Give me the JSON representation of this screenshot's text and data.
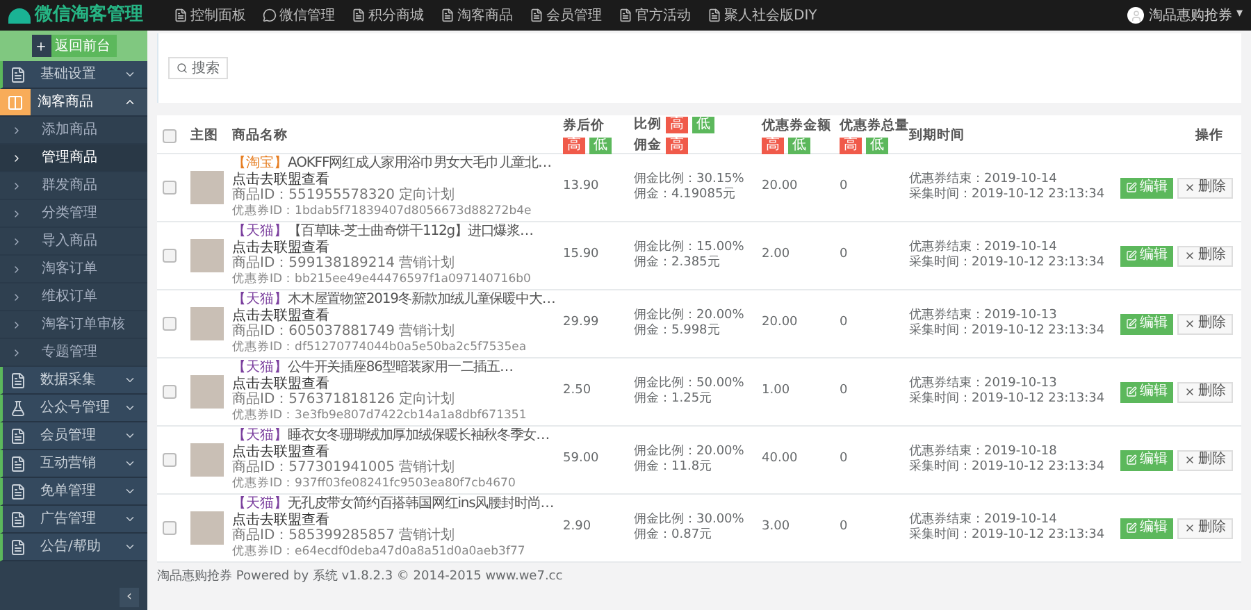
{
  "header": {
    "logo": "微信淘客管理",
    "nav": [
      {
        "label": "控制面板"
      },
      {
        "label": "微信管理"
      },
      {
        "label": "积分商城"
      },
      {
        "label": "淘客商品"
      },
      {
        "label": "会员管理"
      },
      {
        "label": "官方活动"
      },
      {
        "label": "聚人社会版DIY"
      }
    ],
    "user": "淘品惠购抢券",
    "user_caret": "▾"
  },
  "sidebar": {
    "home_button": "返回前台",
    "menu": [
      {
        "label": "基础设置",
        "selected": false,
        "expanded": false
      },
      {
        "label": "淘客商品",
        "selected": true,
        "expanded": true,
        "children": [
          {
            "label": "添加商品",
            "selected": false
          },
          {
            "label": "管理商品",
            "selected": true
          },
          {
            "label": "群发商品",
            "selected": false
          },
          {
            "label": "分类管理",
            "selected": false
          },
          {
            "label": "导入商品",
            "selected": false
          },
          {
            "label": "淘客订单",
            "selected": false
          },
          {
            "label": "维权订单",
            "selected": false
          },
          {
            "label": "淘客订单审核",
            "selected": false
          },
          {
            "label": "专题管理",
            "selected": false
          }
        ]
      },
      {
        "label": "数据采集",
        "selected": false,
        "expanded": false
      },
      {
        "label": "公众号管理",
        "selected": false,
        "expanded": false
      },
      {
        "label": "会员管理",
        "selected": false,
        "expanded": false
      },
      {
        "label": "互动营销",
        "selected": false,
        "expanded": false
      },
      {
        "label": "免单管理",
        "selected": false,
        "expanded": false
      },
      {
        "label": "广告管理",
        "selected": false,
        "expanded": false
      },
      {
        "label": "公告/帮助",
        "selected": false,
        "expanded": false
      }
    ],
    "collapse_button": "‹"
  },
  "search_button": "搜索",
  "table": {
    "select_all_checked": false,
    "columns": [
      {
        "label": "主图"
      },
      {
        "label": "商品名称"
      },
      {
        "label": "券后价",
        "badges": [
          {
            "label": "高",
            "color": "#f05a4a"
          },
          {
            "label": "低",
            "color": "#5cb85c"
          }
        ]
      },
      {
        "label": "比例",
        "badges": [
          {
            "label": "高",
            "color": "#f05a4a"
          },
          {
            "label": "低",
            "color": "#5cb85c"
          }
        ],
        "second_label": "佣金",
        "second_badges": [
          {
            "label": "高",
            "color": "#f05a4a"
          }
        ]
      },
      {
        "label": "优惠券金额",
        "badges": [
          {
            "label": "高",
            "color": "#f05a4a"
          },
          {
            "label": "低",
            "color": "#5cb85c"
          }
        ]
      },
      {
        "label": "优惠券总量",
        "badges": [
          {
            "label": "高",
            "color": "#f05a4a"
          },
          {
            "label": "低",
            "color": "#5cb85c"
          }
        ]
      },
      {
        "label": "到期时间"
      },
      {
        "label": "操作"
      }
    ],
    "rows": [
      {
        "checked": false,
        "platform": {
          "label": "【淘宝】",
          "color": "#e67e22"
        },
        "title": "AOKFF网红成人家用浴巾男女大毛巾儿童北…",
        "link": "点击去联盟查看",
        "item_id": "商品ID：551955578320 定向计划",
        "coupon_id": "优惠券ID：1bdab5f71839407d8056673d88272b4e",
        "price": "13.90",
        "ratio": "佣金比例：30.15%",
        "commission": "佣金：4.19085元",
        "coupon_amount": "20.00",
        "coupon_total": "0",
        "coupon_end": "优惠券结束：2019-10-14",
        "collected": "采集时间：2019-10-12 23:13:34",
        "edit": "编辑",
        "delete": "删除"
      },
      {
        "checked": false,
        "platform": {
          "label": "【天猫】",
          "color": "#7b3f9e"
        },
        "title": "【百草味-芝士曲奇饼干112g】进口爆浆…",
        "link": "点击去联盟查看",
        "item_id": "商品ID：599138189214 营销计划",
        "coupon_id": "优惠券ID：bb215ee49e44476597f1a097140716b0",
        "price": "15.90",
        "ratio": "佣金比例：15.00%",
        "commission": "佣金：2.385元",
        "coupon_amount": "2.00",
        "coupon_total": "0",
        "coupon_end": "优惠券结束：2019-10-14",
        "collected": "采集时间：2019-10-12 23:13:34",
        "edit": "编辑",
        "delete": "删除"
      },
      {
        "checked": false,
        "platform": {
          "label": "【天猫】",
          "color": "#7b3f9e"
        },
        "title": "木木屋置物篮2019冬新款加绒儿童保暖中大…",
        "link": "点击去联盟查看",
        "item_id": "商品ID：605037881749 营销计划",
        "coupon_id": "优惠券ID：df51270774044b0a5e50ba2c5f7535ea",
        "price": "29.99",
        "ratio": "佣金比例：20.00%",
        "commission": "佣金：5.998元",
        "coupon_amount": "20.00",
        "coupon_total": "0",
        "coupon_end": "优惠券结束：2019-10-13",
        "collected": "采集时间：2019-10-12 23:13:34",
        "edit": "编辑",
        "delete": "删除"
      },
      {
        "checked": false,
        "platform": {
          "label": "【天猫】",
          "color": "#7b3f9e"
        },
        "title": "公牛开关插座86型暗装家用一二插五…",
        "link": "点击去联盟查看",
        "item_id": "商品ID：576371818126 定向计划",
        "coupon_id": "优惠券ID：3e3fb9e807d7422cb14a1a8dbf671351",
        "price": "2.50",
        "ratio": "佣金比例：50.00%",
        "commission": "佣金：1.25元",
        "coupon_amount": "1.00",
        "coupon_total": "0",
        "coupon_end": "优惠券结束：2019-10-13",
        "collected": "采集时间：2019-10-12 23:13:34",
        "edit": "编辑",
        "delete": "删除"
      },
      {
        "checked": false,
        "platform": {
          "label": "【天猫】",
          "color": "#7b3f9e"
        },
        "title": "睡衣女冬珊瑚绒加厚加绒保暖长袖秋冬季女…",
        "link": "点击去联盟查看",
        "item_id": "商品ID：577301941005 营销计划",
        "coupon_id": "优惠券ID：937ff03fe08241fc9503ea80f7cb4670",
        "price": "59.00",
        "ratio": "佣金比例：20.00%",
        "commission": "佣金：11.8元",
        "coupon_amount": "40.00",
        "coupon_total": "0",
        "coupon_end": "优惠券结束：2019-10-18",
        "collected": "采集时间：2019-10-12 23:13:34",
        "edit": "编辑",
        "delete": "删除"
      },
      {
        "checked": false,
        "platform": {
          "label": "【天猫】",
          "color": "#7b3f9e"
        },
        "title": "无孔皮带女简约百搭韩国网红ins风腰封时尚…",
        "link": "点击去联盟查看",
        "item_id": "商品ID：585399285857 营销计划",
        "coupon_id": "优惠券ID：e64ecdf0deba47d0a8a51d0a0aeb3f77",
        "price": "2.90",
        "ratio": "佣金比例：30.00%",
        "commission": "佣金：0.87元",
        "coupon_amount": "3.00",
        "coupon_total": "0",
        "coupon_end": "优惠券结束：2019-10-14",
        "collected": "采集时间：2019-10-12 23:13:34",
        "edit": "编辑",
        "delete": "删除"
      }
    ]
  },
  "footer": "淘品惠购抢券 Powered by 系统 v1.8.2.3 © 2014-2015 www.we7.cc"
}
